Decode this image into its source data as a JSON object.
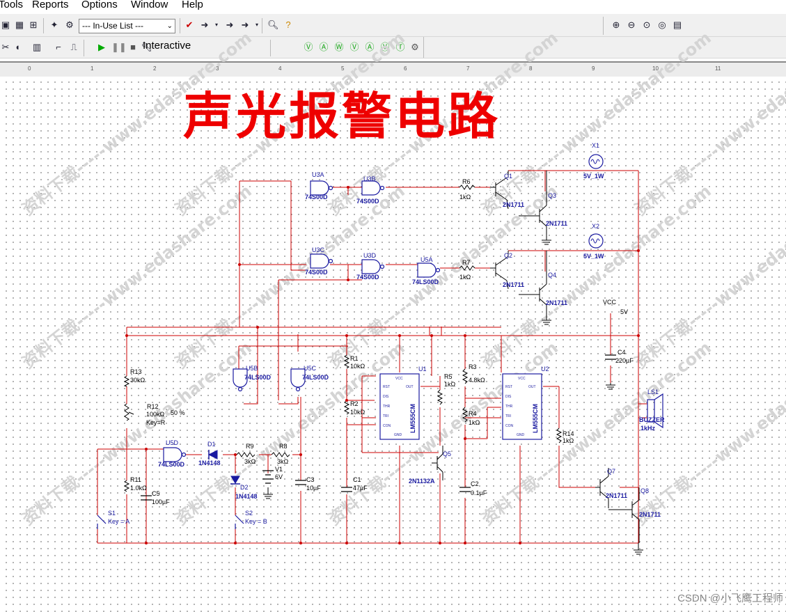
{
  "menu": {
    "tools": "Tools",
    "reports": "Reports",
    "options": "Options",
    "window": "Window",
    "help": "Help"
  },
  "toolbar": {
    "inuse_list": "--- In-Use List ---",
    "interactive_label": "Interactive"
  },
  "ruler": {
    "ticks": [
      "0",
      "1",
      "2",
      "3",
      "4",
      "5",
      "6",
      "7",
      "8",
      "9",
      "10",
      "11"
    ]
  },
  "title": "声光报警电路",
  "watermark": {
    "text": "资料下载-----www.edashare.com"
  },
  "footer": {
    "credit": "CSDN @小飞鹰工程师"
  },
  "components": {
    "u3a": {
      "ref": "U3A",
      "part": "74S00D"
    },
    "u3b": {
      "ref": "U3B",
      "part": "74S00D"
    },
    "u3c": {
      "ref": "U3C",
      "part": "74S00D"
    },
    "u3d": {
      "ref": "U3D",
      "part": "74S00D"
    },
    "u5a": {
      "ref": "U5A",
      "part": "74LS00D"
    },
    "u5b": {
      "ref": "U5B",
      "part": "74LS00D"
    },
    "u5c": {
      "ref": "U5C",
      "part": "74LS00D"
    },
    "u5d": {
      "ref": "U5D",
      "part": "74LS00D"
    },
    "r6": {
      "ref": "R6",
      "value": "1kΩ"
    },
    "r7": {
      "ref": "R7",
      "value": "1kΩ"
    },
    "q1": {
      "ref": "Q1",
      "part": "2N1711"
    },
    "q2": {
      "ref": "Q2",
      "part": "2N1711"
    },
    "q3": {
      "ref": "Q3",
      "part": "2N1711"
    },
    "q4": {
      "ref": "Q4",
      "part": "2N1711"
    },
    "q5": {
      "ref": "Q5",
      "part": "2N1132A"
    },
    "q7": {
      "ref": "Q7",
      "part": "2N1711"
    },
    "q8": {
      "ref": "Q8",
      "part": "2N1711"
    },
    "x1": {
      "ref": "X1",
      "value": "5V_1W"
    },
    "x2": {
      "ref": "X2",
      "value": "5V_1W"
    },
    "vcc": {
      "ref": "VCC",
      "value": "5V"
    },
    "c4": {
      "ref": "C4",
      "value": "220µF"
    },
    "ls1": {
      "ref": "LS1",
      "part": "BUZZER",
      "value": "1kHz"
    },
    "r13": {
      "ref": "R13",
      "value": "30kΩ"
    },
    "r12": {
      "ref": "R12",
      "value": "100kΩ",
      "pct": "50 %",
      "key": "Key=R"
    },
    "r11": {
      "ref": "R11",
      "value": "1.0kΩ"
    },
    "c5": {
      "ref": "C5",
      "value": "100µF"
    },
    "s1": {
      "ref": "S1",
      "key": "Key = A"
    },
    "s2": {
      "ref": "S2",
      "key": "Key = B"
    },
    "d1": {
      "ref": "D1",
      "part": "1N4148"
    },
    "d2": {
      "ref": "D2",
      "part": "1N4148"
    },
    "r9": {
      "ref": "R9",
      "value": "3kΩ"
    },
    "r8": {
      "ref": "R8",
      "value": "3kΩ"
    },
    "v1": {
      "ref": "V1",
      "value": "6V"
    },
    "c3": {
      "ref": "C3",
      "value": "10µF"
    },
    "r1": {
      "ref": "R1",
      "value": "10kΩ"
    },
    "r2": {
      "ref": "R2",
      "value": "10kΩ"
    },
    "c1": {
      "ref": "C1",
      "value": "47µF"
    },
    "u1": {
      "ref": "U1",
      "part": "LM555CM"
    },
    "u2": {
      "ref": "U2",
      "part": "LM555CM"
    },
    "r5": {
      "ref": "R5",
      "value": "1kΩ"
    },
    "r3": {
      "ref": "R3",
      "value": "4.8kΩ"
    },
    "r4": {
      "ref": "R4",
      "value": "1kΩ"
    },
    "c2": {
      "ref": "C2",
      "value": "0.1µF"
    },
    "r14": {
      "ref": "R14",
      "value": "1kΩ"
    }
  },
  "ic_pins": {
    "vcc": "VCC",
    "rst": "RST",
    "dis": "DIS",
    "thr": "THR",
    "tri": "TRI",
    "con": "CON",
    "out": "OUT",
    "gnd": "GND"
  }
}
